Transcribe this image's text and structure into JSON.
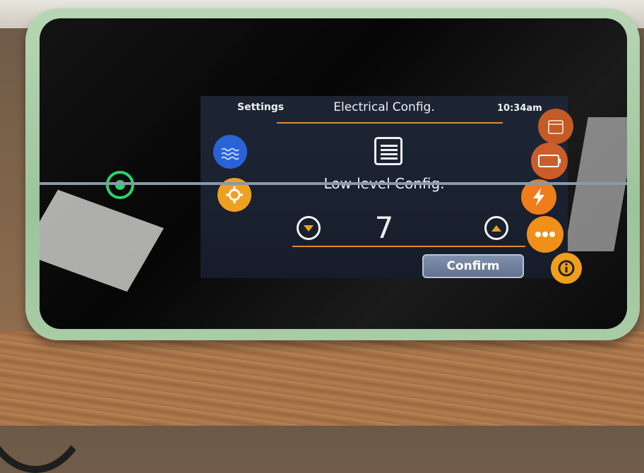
{
  "header": {
    "back_label": "Settings",
    "title": "Electrical Config.",
    "time": "10:34am"
  },
  "main": {
    "item_name": "Low-level Config.",
    "stepper_value": "7",
    "confirm_label": "Confirm"
  },
  "side_icons": {
    "left": [
      "pool-icon",
      "gear-icon"
    ],
    "right": [
      "calendar-icon",
      "battery-icon",
      "lightning-icon",
      "more-icon",
      "info-icon"
    ]
  },
  "colors": {
    "accent": "#e08a2c",
    "screen_bg": "#1d2534",
    "power_green": "#29d46a",
    "pool_blue": "#2a63d6",
    "button_orange": "#f0a020"
  }
}
